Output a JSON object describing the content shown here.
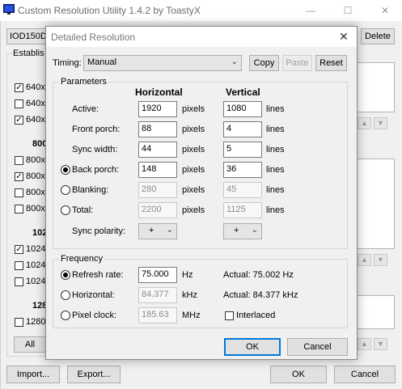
{
  "main": {
    "title": "Custom Resolution Utility 1.4.2 by ToastyX",
    "monitor_combo": "IOD150D",
    "delete_label": "Delete",
    "established_label": "Establis",
    "established_items": [
      {
        "label": "640x",
        "checked": true
      },
      {
        "label": "640x",
        "checked": false
      },
      {
        "label": "640x",
        "checked": true
      }
    ],
    "group_800_label": "800",
    "items_800": [
      {
        "label": "800x",
        "checked": false
      },
      {
        "label": "800x",
        "checked": true
      },
      {
        "label": "800x",
        "checked": false
      },
      {
        "label": "800x",
        "checked": false
      }
    ],
    "group_102_label": "102",
    "items_1024": [
      {
        "label": "1024",
        "checked": true
      },
      {
        "label": "1024",
        "checked": false
      },
      {
        "label": "1024",
        "checked": false
      }
    ],
    "group_128_label": "128",
    "items_1280": [
      {
        "label": "1280",
        "checked": false
      }
    ],
    "all_label": "All",
    "import_label": "Import...",
    "export_label": "Export...",
    "ok_label": "OK",
    "cancel_label": "Cancel"
  },
  "dialog": {
    "title": "Detailed Resolution",
    "timing_label": "Timing:",
    "timing_value": "Manual",
    "copy_label": "Copy",
    "paste_label": "Paste",
    "reset_label": "Reset",
    "parameters_label": "Parameters",
    "horizontal_header": "Horizontal",
    "vertical_header": "Vertical",
    "unit_h": "pixels",
    "unit_v": "lines",
    "rows": [
      {
        "label": "Active:",
        "h": "1920",
        "v": "1080"
      },
      {
        "label": "Front porch:",
        "h": "88",
        "v": "4"
      },
      {
        "label": "Sync width:",
        "h": "44",
        "v": "5"
      },
      {
        "label": "Back porch:",
        "h": "148",
        "v": "36"
      },
      {
        "label": "Blanking:",
        "h": "280",
        "v": "45"
      },
      {
        "label": "Total:",
        "h": "2200",
        "v": "1125"
      }
    ],
    "sync_polarity_label": "Sync polarity:",
    "sync_h": "+",
    "sync_v": "+",
    "frequency_label": "Frequency",
    "refresh_label": "Refresh rate:",
    "refresh_value": "75.000",
    "refresh_unit": "Hz",
    "refresh_actual": "Actual: 75.002 Hz",
    "hfreq_label": "Horizontal:",
    "hfreq_value": "84.377",
    "hfreq_unit": "kHz",
    "hfreq_actual": "Actual: 84.377 kHz",
    "pclk_label": "Pixel clock:",
    "pclk_value": "185.63",
    "pclk_unit": "MHz",
    "interlaced_label": "Interlaced",
    "ok_label": "OK",
    "cancel_label": "Cancel"
  },
  "colors": {
    "accent": "#0078d7",
    "title_icon": "#1a33a8"
  }
}
